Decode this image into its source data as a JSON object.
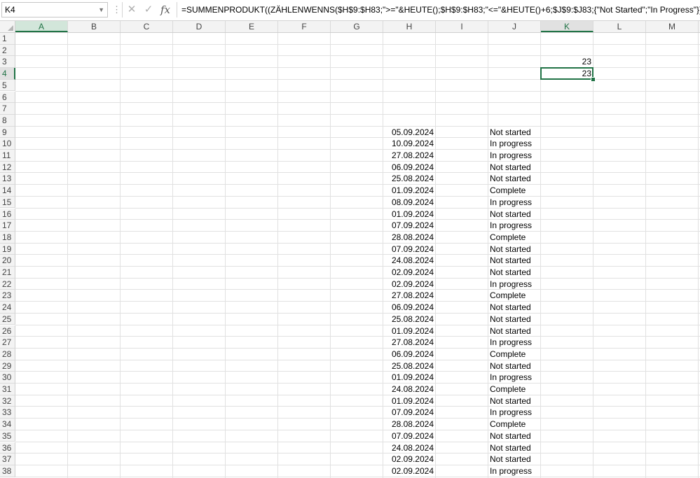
{
  "name_box": "K4",
  "formula_bar": {
    "cancel_icon": "cancel-x-icon",
    "enter_icon": "check-icon",
    "fx_label": "fx",
    "formula": "=SUMMENPRODUKT((ZÄHLENWENNS($H$9:$H83;\">=\"&HEUTE();$H$9:$H83;\"<=\"&HEUTE()+6;$J$9:$J83;{\"Not Started\";\"In Progress\"})))"
  },
  "columns": [
    "A",
    "B",
    "C",
    "D",
    "E",
    "F",
    "G",
    "H",
    "I",
    "J",
    "K",
    "L",
    "M"
  ],
  "selected_column": "K",
  "selected_row": "4",
  "k_values": {
    "K3": "23",
    "K4": "23"
  },
  "rows": [
    {
      "n": "1",
      "h": "",
      "j": ""
    },
    {
      "n": "2",
      "h": "",
      "j": ""
    },
    {
      "n": "3",
      "h": "",
      "j": ""
    },
    {
      "n": "4",
      "h": "",
      "j": ""
    },
    {
      "n": "5",
      "h": "",
      "j": ""
    },
    {
      "n": "6",
      "h": "",
      "j": ""
    },
    {
      "n": "7",
      "h": "",
      "j": ""
    },
    {
      "n": "8",
      "h": "",
      "j": ""
    },
    {
      "n": "9",
      "h": "05.09.2024",
      "j": "Not started"
    },
    {
      "n": "10",
      "h": "10.09.2024",
      "j": "In progress"
    },
    {
      "n": "11",
      "h": "27.08.2024",
      "j": "In progress"
    },
    {
      "n": "12",
      "h": "06.09.2024",
      "j": "Not started"
    },
    {
      "n": "13",
      "h": "25.08.2024",
      "j": "Not started"
    },
    {
      "n": "14",
      "h": "01.09.2024",
      "j": "Complete"
    },
    {
      "n": "15",
      "h": "08.09.2024",
      "j": "In progress"
    },
    {
      "n": "16",
      "h": "01.09.2024",
      "j": "Not started"
    },
    {
      "n": "17",
      "h": "07.09.2024",
      "j": "In progress"
    },
    {
      "n": "18",
      "h": "28.08.2024",
      "j": "Complete"
    },
    {
      "n": "19",
      "h": "07.09.2024",
      "j": "Not started"
    },
    {
      "n": "20",
      "h": "24.08.2024",
      "j": "Not started"
    },
    {
      "n": "21",
      "h": "02.09.2024",
      "j": "Not started"
    },
    {
      "n": "22",
      "h": "02.09.2024",
      "j": "In progress"
    },
    {
      "n": "23",
      "h": "27.08.2024",
      "j": "Complete"
    },
    {
      "n": "24",
      "h": "06.09.2024",
      "j": "Not started"
    },
    {
      "n": "25",
      "h": "25.08.2024",
      "j": "Not started"
    },
    {
      "n": "26",
      "h": "01.09.2024",
      "j": "Not started"
    },
    {
      "n": "27",
      "h": "27.08.2024",
      "j": "In progress"
    },
    {
      "n": "28",
      "h": "06.09.2024",
      "j": "Complete"
    },
    {
      "n": "29",
      "h": "25.08.2024",
      "j": "Not started"
    },
    {
      "n": "30",
      "h": "01.09.2024",
      "j": "In progress"
    },
    {
      "n": "31",
      "h": "24.08.2024",
      "j": "Complete"
    },
    {
      "n": "32",
      "h": "01.09.2024",
      "j": "Not started"
    },
    {
      "n": "33",
      "h": "07.09.2024",
      "j": "In progress"
    },
    {
      "n": "34",
      "h": "28.08.2024",
      "j": "Complete"
    },
    {
      "n": "35",
      "h": "07.09.2024",
      "j": "Not started"
    },
    {
      "n": "36",
      "h": "24.08.2024",
      "j": "Not started"
    },
    {
      "n": "37",
      "h": "02.09.2024",
      "j": "Not started"
    },
    {
      "n": "38",
      "h": "02.09.2024",
      "j": "In progress"
    }
  ],
  "colors": {
    "accent": "#217346"
  }
}
